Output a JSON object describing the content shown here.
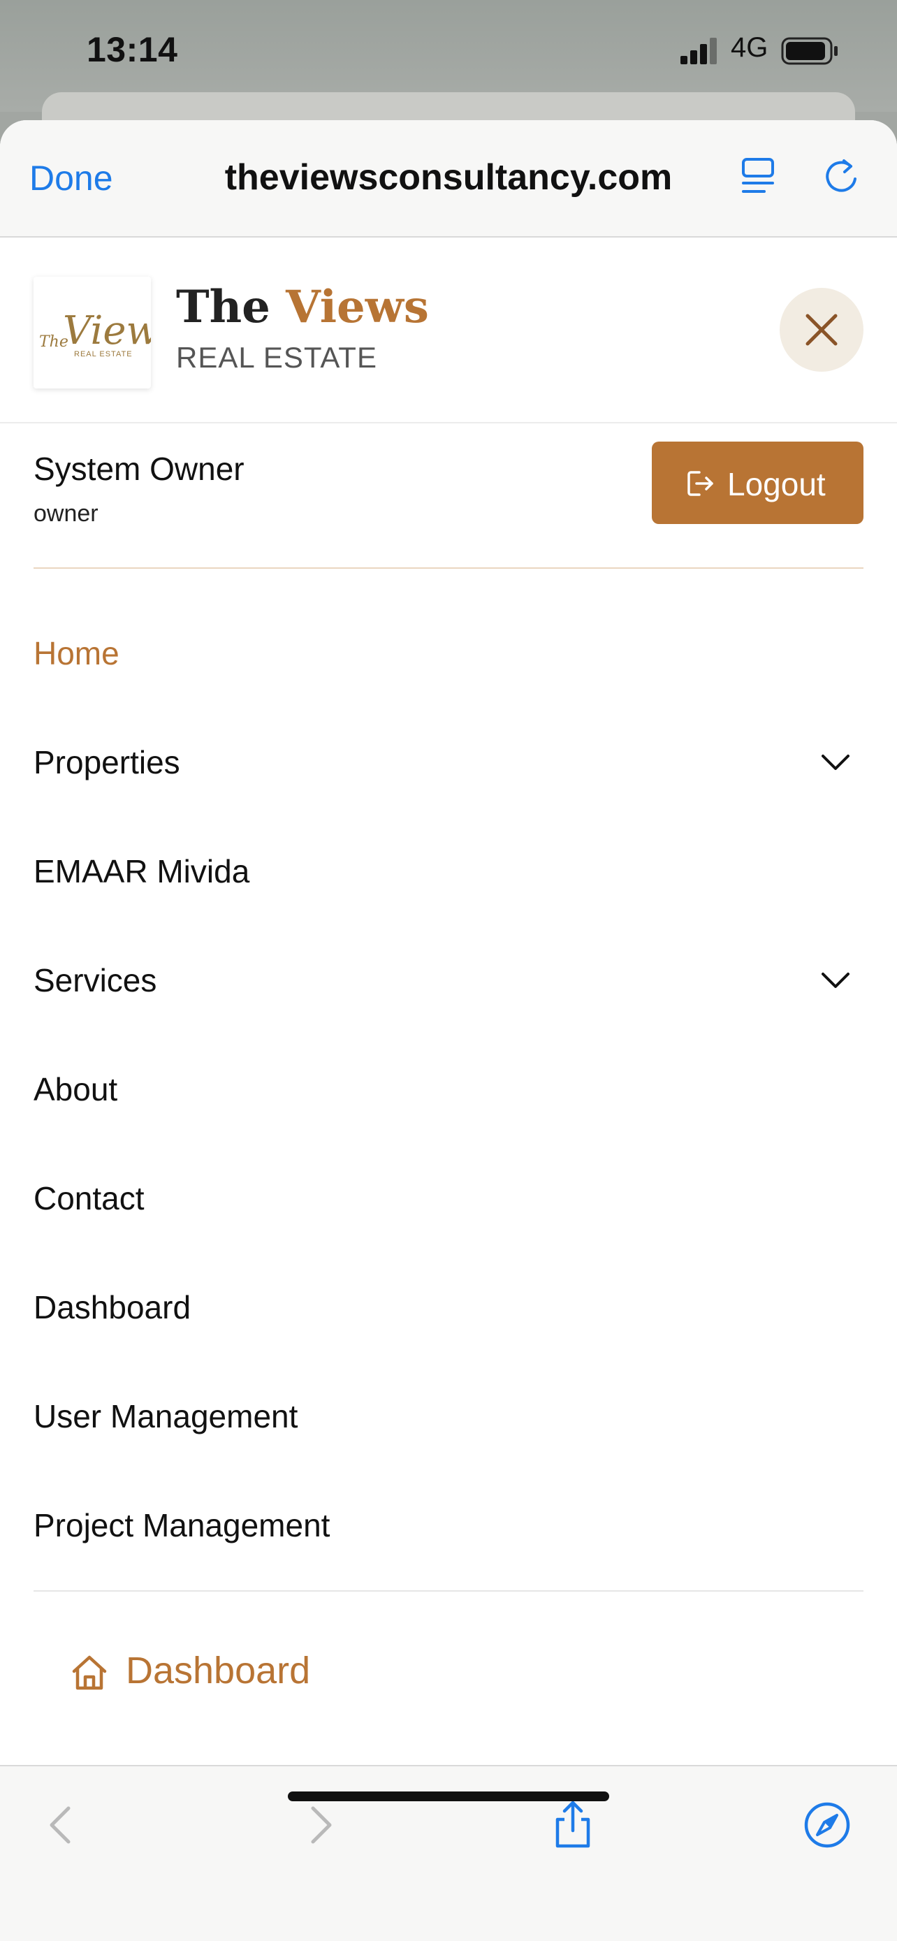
{
  "status_bar": {
    "time": "13:14",
    "network": "4G"
  },
  "safari": {
    "done_label": "Done",
    "url": "theviewsconsultancy.com"
  },
  "site": {
    "brand_title_part1": "The ",
    "brand_title_part2": "Views",
    "brand_subtitle": "REAL ESTATE",
    "logo_text_script": "The Views",
    "logo_text_small": "REAL ESTATE",
    "accent_color": "#b87434"
  },
  "user": {
    "name": "System Owner",
    "role": "owner",
    "logout_label": "Logout"
  },
  "nav": {
    "items": [
      {
        "label": "Home",
        "active": true,
        "has_dropdown": false
      },
      {
        "label": "Properties",
        "active": false,
        "has_dropdown": true
      },
      {
        "label": "EMAAR Mivida",
        "active": false,
        "has_dropdown": false
      },
      {
        "label": "Services",
        "active": false,
        "has_dropdown": true
      },
      {
        "label": "About",
        "active": false,
        "has_dropdown": false
      },
      {
        "label": "Contact",
        "active": false,
        "has_dropdown": false
      },
      {
        "label": "Dashboard",
        "active": false,
        "has_dropdown": false
      },
      {
        "label": "User Management",
        "active": false,
        "has_dropdown": false
      },
      {
        "label": "Project Management",
        "active": false,
        "has_dropdown": false
      }
    ],
    "bottom_link": {
      "label": "Dashboard",
      "icon": "home-icon"
    }
  },
  "toolbar": {
    "icons": [
      "back-icon",
      "forward-icon",
      "share-icon",
      "compass-icon"
    ]
  }
}
